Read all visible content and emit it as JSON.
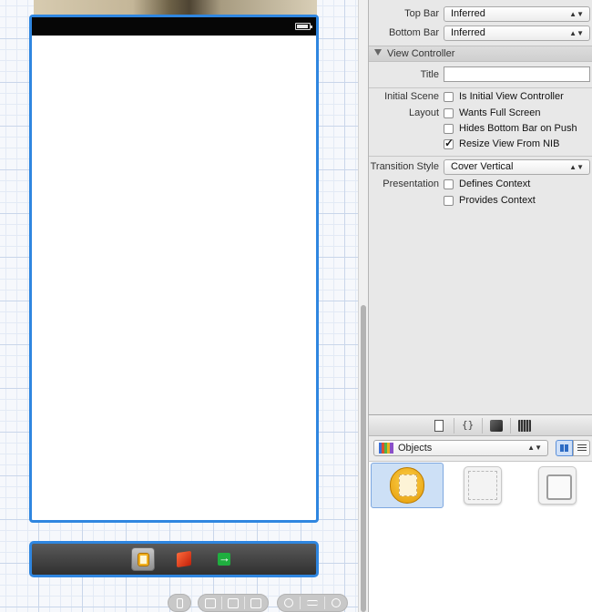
{
  "inspector": {
    "simulated_metrics": [
      {
        "label": "Top Bar",
        "value": "Inferred"
      },
      {
        "label": "Bottom Bar",
        "value": "Inferred"
      }
    ],
    "section_title": "View Controller",
    "title_label": "Title",
    "title_value": "",
    "initial_scene": {
      "label": "Initial Scene",
      "option": "Is Initial View Controller",
      "checked": false
    },
    "layout": {
      "label": "Layout",
      "options": [
        {
          "text": "Wants Full Screen",
          "checked": false
        },
        {
          "text": "Hides Bottom Bar on Push",
          "checked": false
        },
        {
          "text": "Resize View From NIB",
          "checked": true
        }
      ]
    },
    "transition": {
      "label": "Transition Style",
      "value": "Cover Vertical"
    },
    "presentation": {
      "label": "Presentation",
      "options": [
        {
          "text": "Defines Context",
          "checked": false
        },
        {
          "text": "Provides Context",
          "checked": false
        }
      ]
    }
  },
  "library": {
    "tabs": [
      "file-template-icon",
      "code-snippet-icon",
      "object-cube-icon",
      "media-icon"
    ],
    "filter_label": "Objects",
    "items": [
      "view-controller-icon",
      "navigation-controller-icon",
      "tab-bar-controller-icon"
    ]
  },
  "canvas": {
    "dock_icons": [
      "view-controller-icon",
      "first-responder-cube-icon",
      "exit-icon"
    ],
    "zoom_controls": [
      "device-icon",
      "align-icon",
      "pin-icon",
      "resolve-icon",
      "zoom-out-icon",
      "actual-size-icon",
      "zoom-in-icon"
    ]
  },
  "colors": {
    "selection": "#2f86e0",
    "status_bar": "#060606",
    "inspector_bg": "#e8e8e8"
  }
}
